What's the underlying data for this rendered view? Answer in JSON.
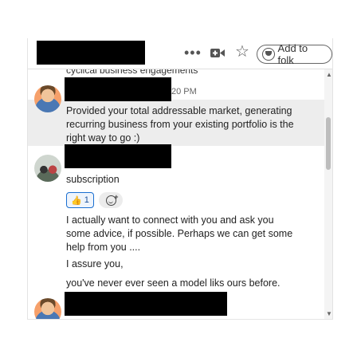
{
  "header": {
    "more_label": "•••",
    "add_button_label": "Add to folk"
  },
  "conversation": {
    "cut_off_text": "cyclical business engagements",
    "msg1": {
      "time_fragment": "20 PM",
      "text": "Provided your total addressable market, generating recurring business from your existing portfolio is the right way to go :)"
    },
    "msg2": {
      "line1": "subscription",
      "reaction_count": "1",
      "line2": "I actually want to connect with you and ask you some advice, if possible. Perhaps we can get some help from you ....",
      "line3": "I assure you,",
      "line4": "you've never ever seen a model liks ours before."
    }
  },
  "icons": [
    "more-icon",
    "video-icon",
    "star-icon",
    "folk-icon",
    "thumbs-up-icon",
    "add-reaction-icon"
  ],
  "colors": {
    "reaction_border": "#1a6fd1",
    "highlight": "#ededed"
  }
}
